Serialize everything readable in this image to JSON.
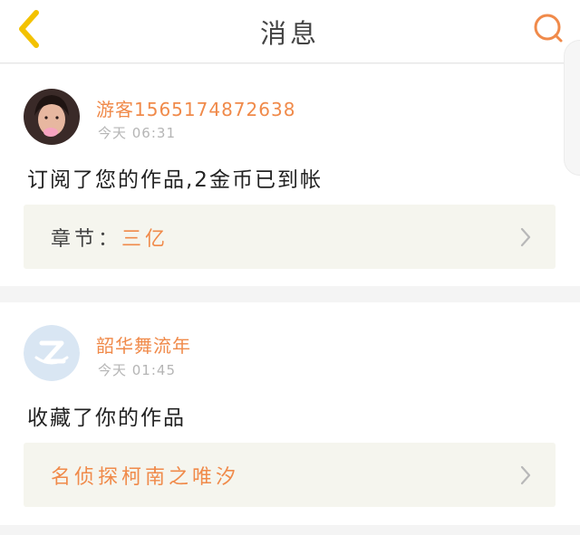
{
  "header": {
    "title": "消息",
    "back_icon": "chevron-left-icon",
    "search_icon": "search-icon",
    "accent_back": "#f3c200",
    "accent_search": "#f08a4a"
  },
  "messages": [
    {
      "username": "游客1565174872638",
      "time": "今天 06:31",
      "text": "订阅了您的作品,2金币已到帐",
      "link": {
        "label": "章节：",
        "value": "三亿"
      }
    },
    {
      "username": "韶华舞流年",
      "time": "今天 01:45",
      "text": "收藏了你的作品",
      "link": {
        "label": "",
        "value": "名侦探柯南之唯汐"
      }
    }
  ]
}
